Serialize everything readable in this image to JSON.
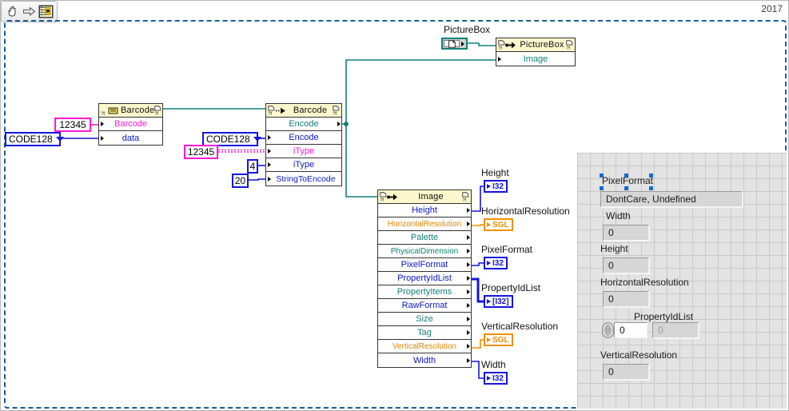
{
  "toolbar": {
    "buttons": [
      {
        "name": "hand-tool",
        "icon": "hand-icon",
        "title": "Operate Value"
      },
      {
        "name": "arrow-tool",
        "icon": "arrow-right-icon",
        "title": "Position/Size/Select"
      },
      {
        "name": "run-tool",
        "icon": "block-diagram-icon",
        "title": "Show Block Diagram"
      }
    ]
  },
  "version_badge": "2017",
  "diagram": {
    "barcode_ref_node": {
      "title": "Barcode",
      "rows": [
        {
          "label": "Barcode",
          "color": "magenta"
        },
        {
          "label": "data",
          "color": "blue"
        }
      ]
    },
    "barcode_encode_node": {
      "title": "Barcode",
      "rows": [
        {
          "label": "Encode",
          "color": "teal"
        },
        {
          "label": "Encode",
          "color": "blue"
        },
        {
          "label": "iType",
          "color": "magenta"
        },
        {
          "label": "iType",
          "color": "blue"
        },
        {
          "label": "StringToEncode",
          "color": "blue"
        }
      ]
    },
    "picturebox_node": {
      "title": "PictureBox",
      "rows": [
        {
          "label": "Image",
          "color": "teal"
        }
      ]
    },
    "image_node": {
      "title": "Image",
      "rows": [
        {
          "label": "Height",
          "color": "blue"
        },
        {
          "label": "HorizontalResolution",
          "color": "orange"
        },
        {
          "label": "Palette",
          "color": "teal"
        },
        {
          "label": "PhysicalDimension",
          "color": "teal"
        },
        {
          "label": "PixelFormat",
          "color": "blue"
        },
        {
          "label": "PropertyIdList",
          "color": "blue"
        },
        {
          "label": "PropertyItems",
          "color": "teal"
        },
        {
          "label": "RawFormat",
          "color": "blue"
        },
        {
          "label": "Size",
          "color": "teal"
        },
        {
          "label": "Tag",
          "color": "teal"
        },
        {
          "label": "VerticalResolution",
          "color": "orange"
        },
        {
          "label": "Width",
          "color": "blue"
        }
      ]
    },
    "constants": [
      {
        "name": "code128-enum-left",
        "value": "CODE128",
        "kind": "enum",
        "color": "blue"
      },
      {
        "name": "numeric-12345-left",
        "value": "12345",
        "kind": "numeric",
        "color": "pink"
      },
      {
        "name": "code128-enum-right",
        "value": "CODE128",
        "kind": "enum",
        "color": "blue"
      },
      {
        "name": "numeric-12345-right",
        "value": "12345",
        "kind": "numeric",
        "color": "pink"
      },
      {
        "name": "numeric-4",
        "value": "4",
        "kind": "numeric",
        "color": "blue"
      },
      {
        "name": "numeric-20",
        "value": "20",
        "kind": "numeric",
        "color": "blue"
      }
    ],
    "picturebox_control_label": "PictureBox",
    "indicators": [
      {
        "name": "height-indicator",
        "label": "Height",
        "type": "I32",
        "color": "blue"
      },
      {
        "name": "horizontalresolution-indicator",
        "label": "HorizontalResolution",
        "type": "SGL",
        "color": "orange"
      },
      {
        "name": "pixelformat-indicator",
        "label": "PixelFormat",
        "type": "I32",
        "color": "blue"
      },
      {
        "name": "propertyidlist-indicator",
        "label": "PropertyIdList",
        "type": "[I32]",
        "color": "blue"
      },
      {
        "name": "verticalresolution-indicator",
        "label": "VerticalResolution",
        "type": "SGL",
        "color": "orange"
      },
      {
        "name": "width-indicator",
        "label": "Width",
        "type": "I32",
        "color": "blue"
      }
    ]
  },
  "front_panel": {
    "pixelformat": {
      "label": "PixelFormat",
      "value": "DontCare, Undefined",
      "selected": true
    },
    "width": {
      "label": "Width",
      "value": "0"
    },
    "height": {
      "label": "Height",
      "value": "0"
    },
    "horizontal_resolution": {
      "label": "HorizontalResolution",
      "value": "0"
    },
    "propertyidlist": {
      "label": "PropertyIdList",
      "index_value": "0",
      "value": "0"
    },
    "vertical_resolution": {
      "label": "VerticalResolution",
      "value": "0"
    }
  },
  "colors": {
    "wire_teal": "#128078",
    "wire_blue": "#1414e0",
    "wire_orange": "#f09000",
    "wire_broken": "#ff17d9",
    "node_header": "#fcf7cd",
    "diagram_border": "#1a5d96"
  }
}
